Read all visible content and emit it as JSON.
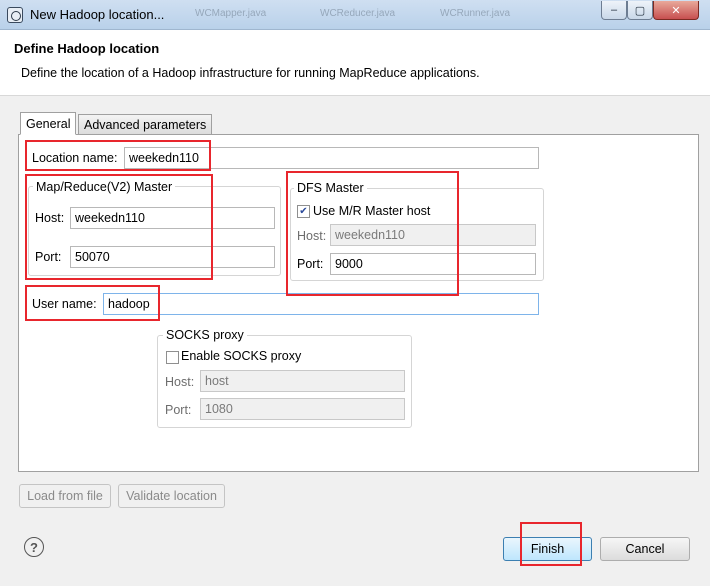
{
  "window": {
    "title": "New Hadoop location...",
    "background_tabs": [
      "WCMapper.java",
      "WCReducer.java",
      "WCRunner.java"
    ],
    "controls": {
      "minimize": "–",
      "maximize": "▢",
      "close": "✕"
    }
  },
  "header": {
    "title": "Define Hadoop location",
    "description": "Define the location of a Hadoop infrastructure for running MapReduce applications."
  },
  "tabs": [
    {
      "label": "General",
      "selected": true
    },
    {
      "label": "Advanced parameters",
      "selected": false
    }
  ],
  "general": {
    "location_name": {
      "label": "Location name:",
      "value": "weekedn110"
    },
    "mr_master": {
      "title": "Map/Reduce(V2) Master",
      "host": {
        "label": "Host:",
        "value": "weekedn110"
      },
      "port": {
        "label": "Port:",
        "value": "50070"
      }
    },
    "dfs_master": {
      "title": "DFS Master",
      "use_mr_host": {
        "label": "Use M/R Master host",
        "checked": true
      },
      "host": {
        "label": "Host:",
        "value": "weekedn110",
        "enabled": false
      },
      "port": {
        "label": "Port:",
        "value": "9000"
      }
    },
    "user_name": {
      "label": "User name:",
      "value": "hadoop"
    },
    "socks_proxy": {
      "title": "SOCKS proxy",
      "enable": {
        "label": "Enable SOCKS proxy",
        "checked": false
      },
      "host": {
        "label": "Host:",
        "value": "host",
        "enabled": false
      },
      "port": {
        "label": "Port:",
        "value": "1080",
        "enabled": false
      }
    }
  },
  "actions": {
    "load_from_file": "Load from file",
    "validate_location": "Validate location"
  },
  "footer": {
    "help": "?",
    "finish": "Finish",
    "cancel": "Cancel"
  },
  "colors": {
    "highlight_box": "#e8262d",
    "title_bar": "#b9d1ea"
  },
  "icons": {
    "help": "help-icon",
    "window": "app-icon",
    "checkbox_checked": "check-icon"
  }
}
